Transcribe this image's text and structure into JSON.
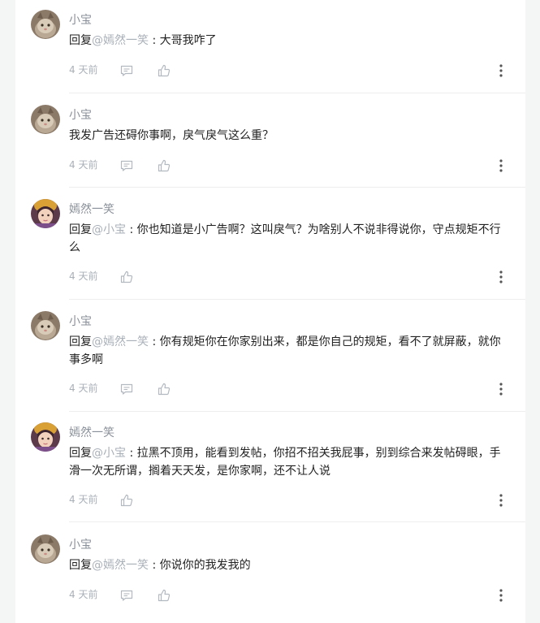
{
  "comments": [
    {
      "user": "小宝",
      "reply_kw": "回复",
      "mention": "@嫣然一笑",
      "sep": " : ",
      "text": "大哥我咋了",
      "time": "4 天前"
    },
    {
      "user": "小宝",
      "reply_kw": "",
      "mention": "",
      "sep": "",
      "text": "我发广告还碍你事啊，戾气戾气这么重？",
      "time": "4 天前"
    },
    {
      "user": "嫣然一笑",
      "reply_kw": "回复",
      "mention": "@小宝",
      "sep": " : ",
      "text": "你也知道是小广告啊？这叫戾气？为啥别人不说非得说你，守点规矩不行么",
      "time": "4 天前"
    },
    {
      "user": "小宝",
      "reply_kw": "回复",
      "mention": "@嫣然一笑",
      "sep": " : ",
      "text": "你有规矩你在你家别出来，都是你自己的规矩，看不了就屏蔽，就你事多啊",
      "time": "4 天前"
    },
    {
      "user": "嫣然一笑",
      "reply_kw": "回复",
      "mention": "@小宝",
      "sep": " : ",
      "text": "拉黑不顶用，能看到发帖，你招不招关我屁事，别到综合来发帖碍眼，手滑一次无所谓，搁着天天发，是你家啊，还不让人说",
      "time": "4 天前"
    },
    {
      "user": "小宝",
      "reply_kw": "回复",
      "mention": "@嫣然一笑",
      "sep": " : ",
      "text": "你说你的我发我的",
      "time": "4 天前"
    }
  ],
  "icons": {
    "comment": "comment-icon",
    "like": "thumbs-up-icon",
    "more": "more-vertical-icon",
    "avatar_xiaobao": "cat-avatar",
    "avatar_yanran": "girl-avatar"
  },
  "colors": {
    "name": "#8a9099",
    "mention": "#a9b0b8",
    "text": "#222222",
    "meta": "#a9b0b8",
    "background": "#f4f5f5"
  }
}
